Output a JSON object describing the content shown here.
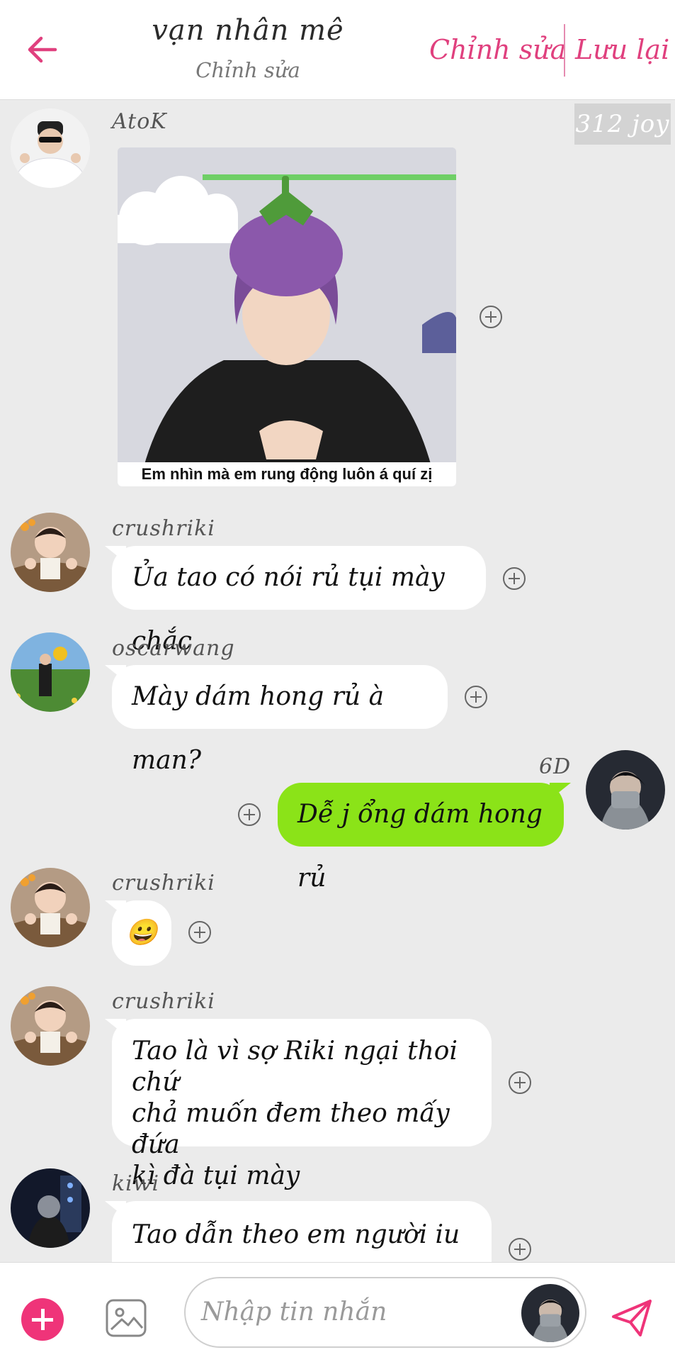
{
  "header": {
    "title": "vạn nhân mê",
    "subtitle": "Chỉnh sửa",
    "edit_label": "Chỉnh sửa",
    "save_label": "Lưu lại",
    "accent_color": "#e0407e"
  },
  "watermark": "312 joy",
  "messages": [
    {
      "sender": "AtoK",
      "type": "image",
      "caption": "Em nhìn mà em rung động luôn á quí zị"
    },
    {
      "sender": "crushriki",
      "type": "text",
      "lines": [
        "Ủa tao có nói rủ tụi mày chắc"
      ]
    },
    {
      "sender": "oscarwang",
      "type": "text",
      "lines": [
        "Mày dám hong rủ à man?"
      ]
    },
    {
      "sender": "6D",
      "type": "text",
      "side": "right",
      "lines": [
        "Dễ j ổng dám hong rủ"
      ],
      "bubble_color": "#8be318"
    },
    {
      "sender": "crushriki",
      "type": "emoji",
      "lines": [
        "😀"
      ]
    },
    {
      "sender": "crushriki",
      "type": "text",
      "lines": [
        "Tao là vì sợ Riki ngại thoi chứ",
        "chả muốn đem theo mấy đứa",
        "kì đà tụi mày"
      ]
    },
    {
      "sender": "kiwi",
      "type": "text",
      "lines": [
        "Tao dẫn theo em người iu"
      ]
    }
  ],
  "composer": {
    "placeholder": "Nhập tin nhắn",
    "fab_color": "#ef3479",
    "send_color": "#ef3479"
  }
}
